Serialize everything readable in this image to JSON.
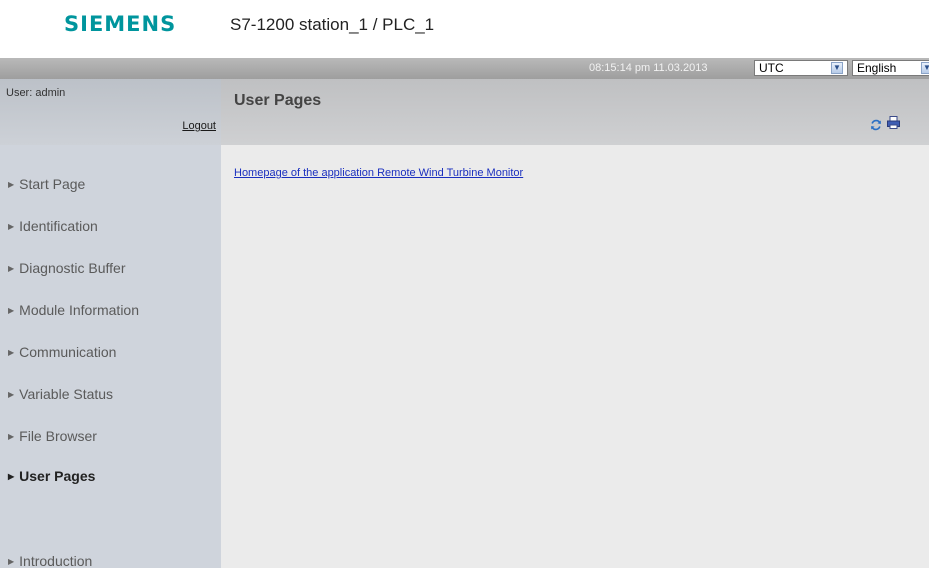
{
  "header": {
    "logo": "SIEMENS",
    "station": "S7-1200 station_1 / PLC_1"
  },
  "topbar": {
    "datetime": "08:15:14 pm  11.03.2013",
    "timezone": "UTC",
    "language": "English"
  },
  "user": {
    "label": "User: admin",
    "logout": "Logout"
  },
  "nav": {
    "items": [
      {
        "label": "Start Page"
      },
      {
        "label": "Identification"
      },
      {
        "label": "Diagnostic Buffer"
      },
      {
        "label": "Module Information"
      },
      {
        "label": "Communication"
      },
      {
        "label": "Variable Status"
      },
      {
        "label": "File Browser"
      },
      {
        "label": "User Pages"
      },
      {
        "label": "Introduction"
      }
    ],
    "active": "User Pages"
  },
  "main": {
    "title": "User Pages",
    "link": "Homepage of the application Remote Wind Turbine Monitor"
  },
  "icons": {
    "refresh": "refresh-icon",
    "print": "print-icon",
    "arrow": "triangle-right-icon"
  },
  "colors": {
    "brand": "#00959d",
    "link": "#1a2fbf"
  }
}
